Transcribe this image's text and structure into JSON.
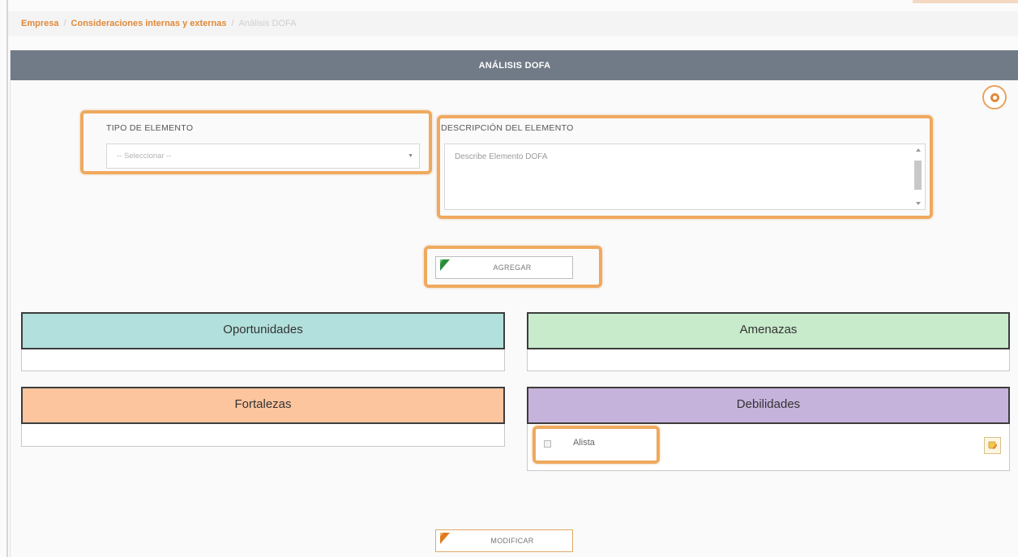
{
  "breadcrumb": {
    "items": [
      "Empresa",
      "Consideraciones internas y externas"
    ],
    "current": "Análisis DOFA"
  },
  "header": {
    "title": "ANÁLISIS DOFA"
  },
  "help": {
    "icon": "help-icon"
  },
  "form": {
    "type_label": "TIPO DE ELEMENTO",
    "type_value": "-- Seleccionar --",
    "desc_label": "DESCRIPCIÓN DEL ELEMENTO",
    "desc_placeholder": "Describe Elemento DOFA"
  },
  "buttons": {
    "add_label": "AGREGAR",
    "modify_label": "MODIFICAR"
  },
  "quadrants": {
    "opportunities": {
      "title": "Oportunidades",
      "color": "#b2e0dc",
      "items": []
    },
    "threats": {
      "title": "Amenazas",
      "color": "#c8ebcb",
      "items": []
    },
    "strengths": {
      "title": "Fortalezas",
      "color": "#fdc59e",
      "items": []
    },
    "weaknesses": {
      "title": "Debilidades",
      "color": "#c6b3dc",
      "items": [
        "Alista"
      ]
    }
  },
  "colors": {
    "accent": "#e08a3a",
    "header_bg": "#717b87",
    "highlight": "#f0a95e"
  }
}
